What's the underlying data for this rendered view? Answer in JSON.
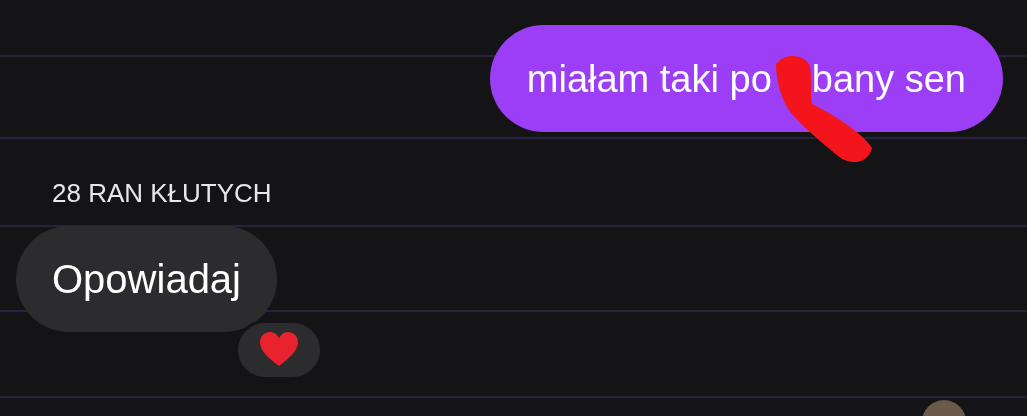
{
  "messages": [
    {
      "kind": "sent",
      "text_parts": [
        "miałam taki po",
        "bany sen"
      ],
      "scribbled": true
    },
    {
      "kind": "sender_name",
      "text": "28 RAN KŁUTYCH"
    },
    {
      "kind": "received",
      "text": "Opowiadaj",
      "reaction": true
    }
  ],
  "avatar": true
}
